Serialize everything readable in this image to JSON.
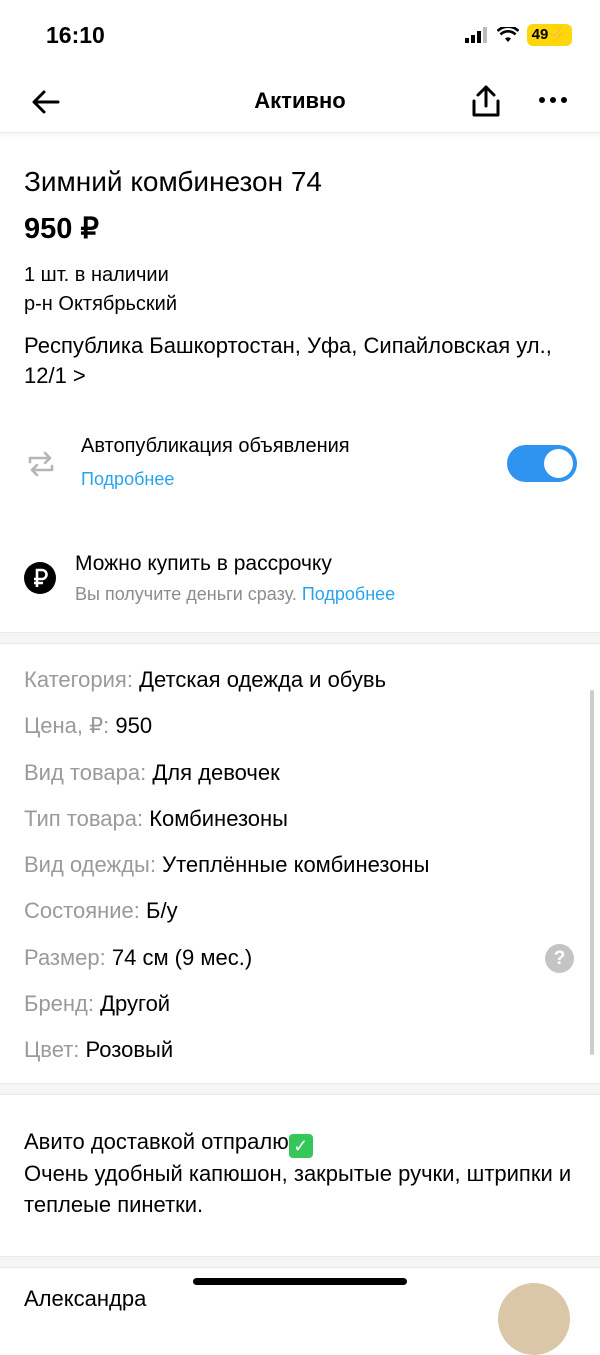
{
  "status_bar": {
    "time": "16:10",
    "battery": "49"
  },
  "nav": {
    "title": "Активно"
  },
  "listing": {
    "title": "Зимний комбинезон 74",
    "price": "950 ₽",
    "stock": "1 шт. в наличии",
    "district": "р-н Октябрьский",
    "address": "Республика Башкортостан, Уфа, Сипайловская ул., 12/1 >"
  },
  "autopublish": {
    "label": "Автопубликация объявления",
    "link": "Подробнее",
    "enabled": true
  },
  "installment": {
    "label": "Можно купить в рассрочку",
    "sub": "Вы получите деньги сразу.",
    "link": "Подробнее"
  },
  "params": [
    {
      "key": "Категория:",
      "value": "Детская одежда и обувь"
    },
    {
      "key": "Цена, ₽:",
      "value": "950"
    },
    {
      "key": "Вид товара:",
      "value": "Для девочек"
    },
    {
      "key": "Тип товара:",
      "value": "Комбинезоны"
    },
    {
      "key": "Вид одежды:",
      "value": "Утеплённые комбинезоны"
    },
    {
      "key": "Состояние:",
      "value": "Б/у"
    },
    {
      "key": "Размер:",
      "value": "74 см (9 мес.)"
    },
    {
      "key": "Бренд:",
      "value": "Другой"
    },
    {
      "key": "Цвет:",
      "value": "Розовый"
    }
  ],
  "description": {
    "line1": "Авито доставкой отпралю",
    "line2": "Очень удобный капюшон, закрытые ручки, штрипки и теплеые пинетки."
  },
  "seller": {
    "name": "Александра"
  },
  "colors": {
    "accent": "#2aa3ed",
    "toggle": "#2f93f0",
    "battery": "#ffd60a"
  }
}
